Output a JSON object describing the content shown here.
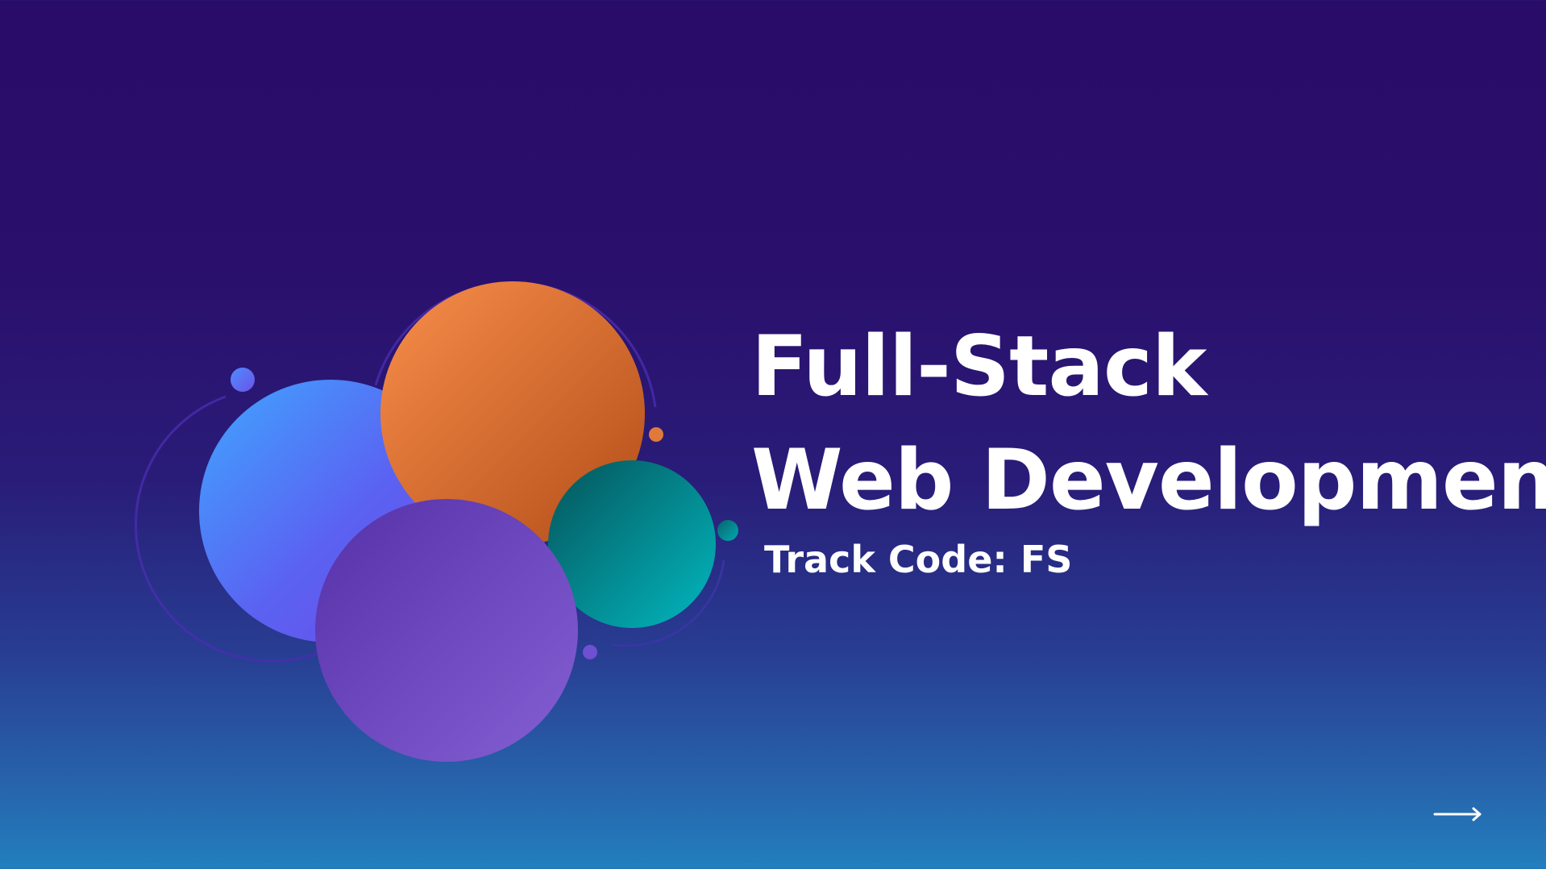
{
  "slide": {
    "title_line1": "Full-Stack",
    "title_line2": "Web Development",
    "subtitle": "Track Code: FS"
  },
  "navigation": {
    "next_icon": "arrow-right-icon"
  },
  "colors": {
    "background_top": "#290b69",
    "background_bottom": "#227fbe",
    "circle_blue": "#5a63f3",
    "circle_orange": "#e07a3a",
    "circle_teal": "#03989e",
    "circle_purple": "#6a46bd",
    "text": "#ffffff"
  }
}
